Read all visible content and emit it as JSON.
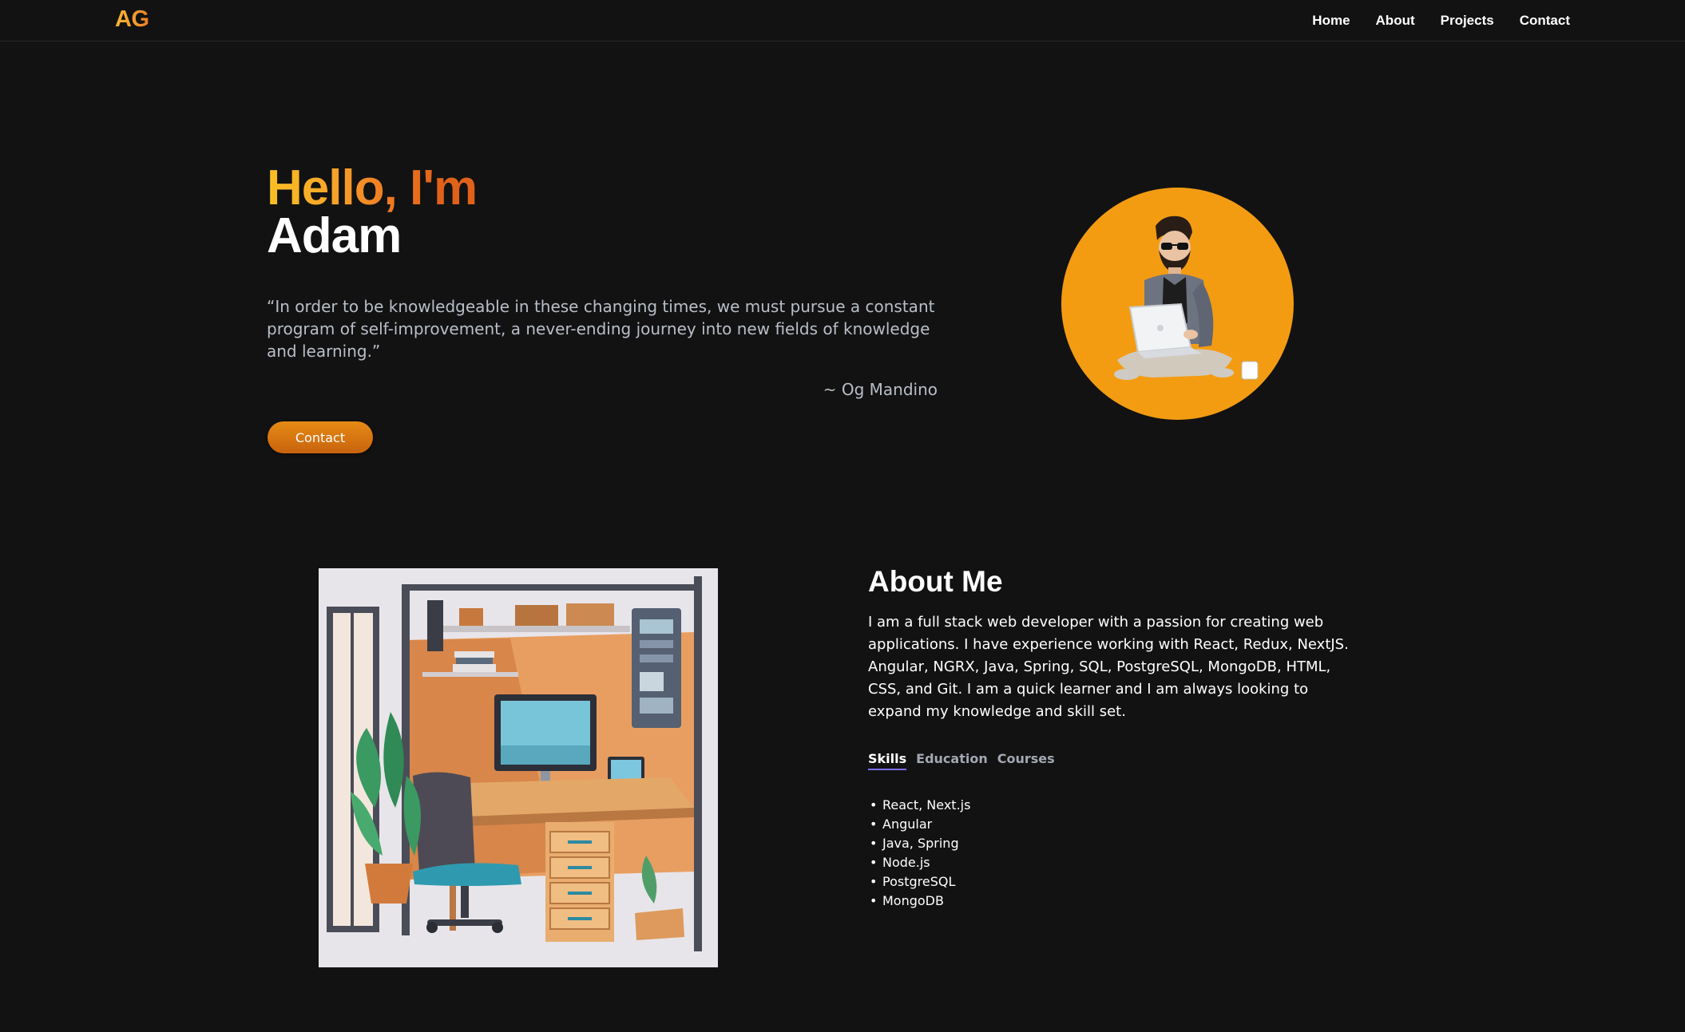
{
  "nav": {
    "logo": "AG",
    "links": [
      "Home",
      "About",
      "Projects",
      "Contact"
    ]
  },
  "hero": {
    "greeting": "Hello, I'm",
    "name": "Adam",
    "quote": "“In order to be knowledgeable in these changing times, we must pursue a constant program of self-improvement, a never-ending journey into new fields of knowledge and learning.”",
    "author": "~ Og Mandino",
    "contact_button": "Contact"
  },
  "about": {
    "title": "About Me",
    "description": "I am a full stack web developer with a passion for creating web applications. I have experience working with React, Redux, NextJS. Angular, NGRX, Java, Spring, SQL, PostgreSQL, MongoDB, HTML, CSS, and Git. I am a quick learner and I am always looking to expand my knowledge and skill set.",
    "tabs": [
      "Skills",
      "Education",
      "Courses"
    ],
    "active_tab": "Skills",
    "skills": [
      "React, Next.js",
      "Angular",
      "Java, Spring",
      "Node.js",
      "PostgreSQL",
      "MongoDB"
    ]
  },
  "colors": {
    "background": "#121212",
    "accent_orange": "#f39c12",
    "accent_gradient_start": "#fbbf24",
    "accent_gradient_end": "#e0621a",
    "tab_underline": "#7c6cf0"
  },
  "icons": {
    "avatar": "developer-with-laptop-illustration",
    "about_image": "office-desk-illustration"
  }
}
